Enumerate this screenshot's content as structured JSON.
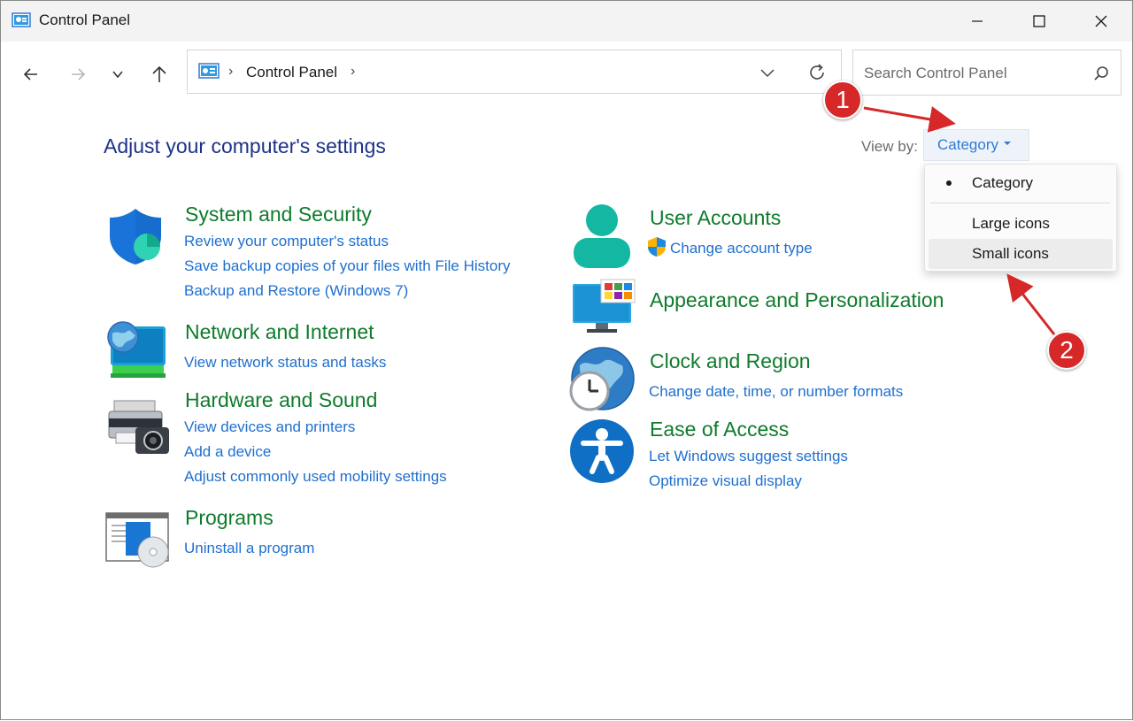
{
  "window": {
    "title": "Control Panel",
    "controls": {
      "minimize": "minimize-icon",
      "maximize": "maximize-icon",
      "close": "close-icon"
    }
  },
  "nav": {
    "breadcrumb": "Control Panel",
    "search_placeholder": "Search Control Panel"
  },
  "content": {
    "heading": "Adjust your computer's settings",
    "view_by_label": "View by:",
    "view_by_value": "Category",
    "view_menu": [
      "Category",
      "Large icons",
      "Small icons"
    ],
    "categories": [
      {
        "title": "System and Security",
        "links": [
          "Review your computer's status",
          "Save backup copies of your files with File History",
          "Backup and Restore (Windows 7)"
        ]
      },
      {
        "title": "Network and Internet",
        "links": [
          "View network status and tasks"
        ]
      },
      {
        "title": "Hardware and Sound",
        "links": [
          "View devices and printers",
          "Add a device",
          "Adjust commonly used mobility settings"
        ]
      },
      {
        "title": "Programs",
        "links": [
          "Uninstall a program"
        ]
      },
      {
        "title": "User Accounts",
        "links": [
          "Change account type"
        ]
      },
      {
        "title": "Appearance and Personalization",
        "links": []
      },
      {
        "title": "Clock and Region",
        "links": [
          "Change date, time, or number formats"
        ]
      },
      {
        "title": "Ease of Access",
        "links": [
          "Let Windows suggest settings",
          "Optimize visual display"
        ]
      }
    ]
  },
  "annotations": {
    "step1": "1",
    "step2": "2",
    "accent": "#d62828"
  },
  "colors": {
    "heading": "#1e3287",
    "category_title": "#0f7b2c",
    "link": "#1f6fcf"
  }
}
